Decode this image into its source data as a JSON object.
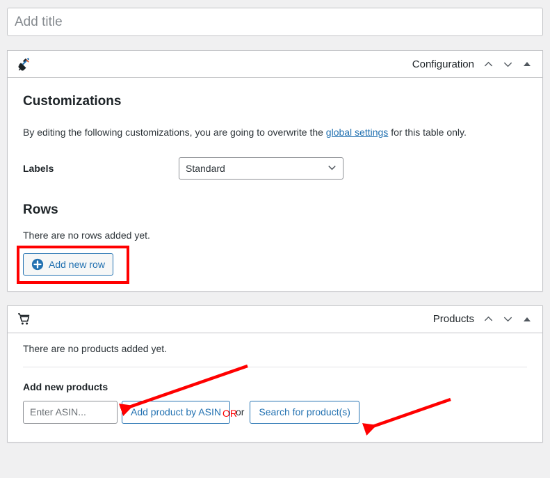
{
  "title_field": {
    "placeholder": "Add title",
    "value": ""
  },
  "panels": [
    {
      "id": "configuration",
      "icon": "plugin-plug-icon",
      "title": "Configuration",
      "controls": {
        "move_up": "⌃",
        "move_down": "⌄",
        "toggle": "▲"
      },
      "section_title": "Customizations",
      "description_before": "By editing the following customizations, you are going to overwrite the ",
      "description_link": "global settings",
      "description_after": " for this table only.",
      "labels_field": {
        "label": "Labels",
        "selected": "Standard",
        "options": [
          "Standard"
        ]
      },
      "rows": {
        "title": "Rows",
        "empty_text": "There are no rows added yet.",
        "add_button": "Add new row"
      }
    },
    {
      "id": "products",
      "icon": "cart-icon",
      "title": "Products",
      "controls": {
        "move_up": "⌃",
        "move_down": "⌄",
        "toggle": "▲"
      },
      "empty_text": "There are no products added yet.",
      "add_new_label": "Add new products",
      "asin_input": {
        "placeholder": "Enter ASIN...",
        "value": ""
      },
      "add_by_asin_button": "Add product by ASIN",
      "separator_word": "or",
      "search_button": "Search for product(s)"
    }
  ],
  "annotations": {
    "or_label": "OR",
    "or_color": "#ff0000",
    "highlight_color": "#ff0000",
    "arrow_color": "#ff0000",
    "highlight_target": "Add new row",
    "arrow_targets": [
      "Add product by ASIN",
      "Search for product(s)"
    ]
  },
  "colors": {
    "page_background": "#f0f0f1",
    "panel_background": "#ffffff",
    "panel_border": "#c3c4c7",
    "link_blue": "#2271b1",
    "text": "#1d2327",
    "annotation_red": "#ff0000"
  }
}
